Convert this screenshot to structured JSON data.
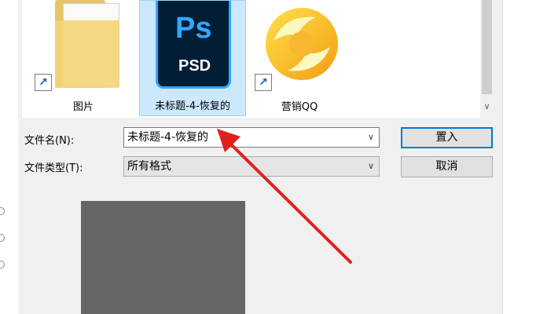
{
  "files": [
    {
      "name": "图片",
      "icon": "folder-icon",
      "shortcut": true,
      "selected": false
    },
    {
      "name": "未标题-4-恢复的",
      "icon": "photoshop-psd-icon",
      "icon_text": "Ps",
      "icon_subtext": "PSD",
      "shortcut": false,
      "selected": true
    },
    {
      "name": "营销QQ",
      "icon": "qq-marketing-icon",
      "shortcut": true,
      "selected": false
    }
  ],
  "form": {
    "filename_label": "文件名(N):",
    "filename_value": "未标题-4-恢复的",
    "filetype_label": "文件类型(T):",
    "filetype_value": "所有格式",
    "place_button": "置入",
    "cancel_button": "取消"
  },
  "icons": {
    "shortcut_arrow": "shortcut-arrow-icon",
    "dropdown": "chevron-down-icon",
    "scroll_down": "scroll-down-icon"
  },
  "colors": {
    "selection_bg": "#cce8ff",
    "selection_border": "#99d1ff",
    "ps_blue": "#31a8ff",
    "ps_dark": "#001e36",
    "annotation_arrow": "#e02020",
    "default_button_border": "#0078d7"
  }
}
